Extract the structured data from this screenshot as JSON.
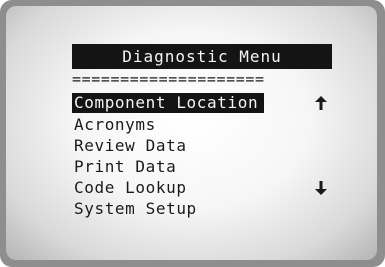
{
  "menu": {
    "title": "Diagnostic Menu",
    "separator": "====================",
    "items": [
      {
        "label": "Component Location",
        "selected": true
      },
      {
        "label": "Acronyms"
      },
      {
        "label": "Review Data"
      },
      {
        "label": "Print Data"
      },
      {
        "label": "Code Lookup"
      },
      {
        "label": "System Setup"
      }
    ]
  },
  "icons": {
    "scroll_up": "up-arrow-icon",
    "scroll_down": "down-arrow-icon"
  },
  "colors": {
    "highlight_bg": "#141414",
    "highlight_text": "#f5f5f5",
    "text": "#1a1a1a"
  }
}
